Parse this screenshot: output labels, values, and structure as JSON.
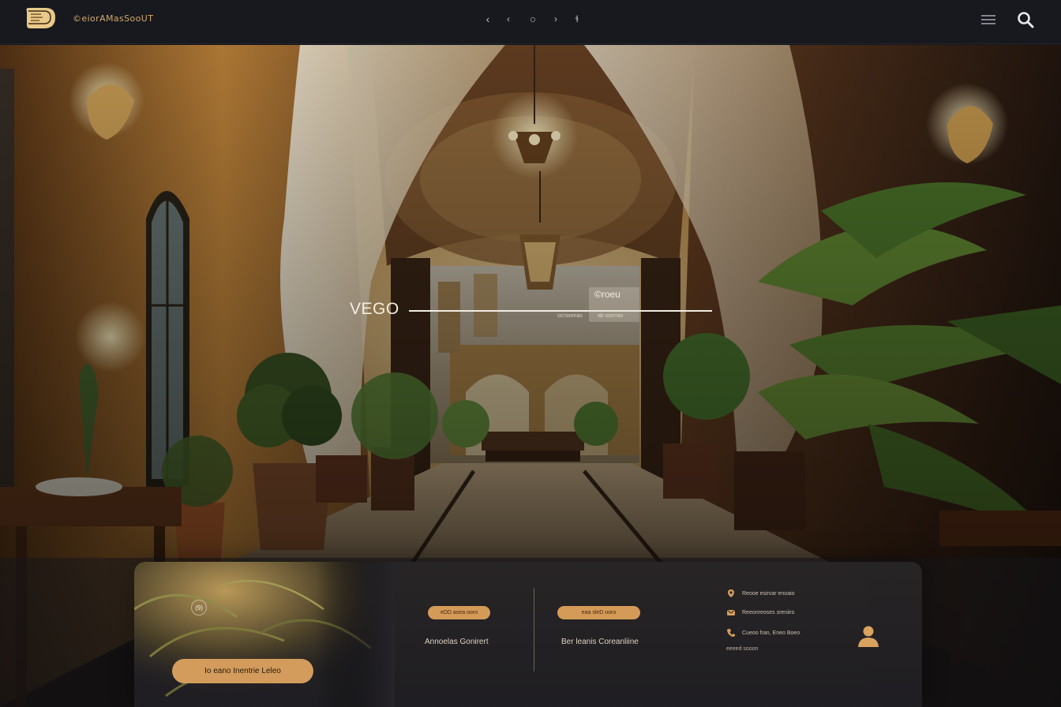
{
  "header": {
    "brand": "©eiorAMasSooUT",
    "nav_icons": [
      "chevron-left-icon",
      "chevron-left-small-icon",
      "circle-icon",
      "chevron-right-icon",
      "shuffle-icon"
    ],
    "nav_glyphs": [
      "‹",
      "‹",
      "○",
      "›",
      "ɬ"
    ]
  },
  "hero": {
    "title": "VEGO",
    "tag": "©roeu",
    "sub_left": "ocrsiomas",
    "sub_right": "ab iosrrsio"
  },
  "panel": {
    "badge": "(9)",
    "cta_label": "Io eano Inentrie Leleo",
    "columns": [
      {
        "pill": "eDD asea ooro",
        "label": "Annoelas Gonirert"
      },
      {
        "pill": "eaa sleD ooro",
        "label": "Ber leanis Coreanliine"
      }
    ],
    "info_rows": [
      "Reooe esirvar enoaio",
      "Reeonreoses sreniiro",
      "Cueoo fran, Eneo Boeo"
    ],
    "info_extra": "eeeed sooon"
  },
  "colors": {
    "accent": "#d39c5d",
    "header_bg": "#17191e",
    "panel_bg": "#27252a"
  }
}
